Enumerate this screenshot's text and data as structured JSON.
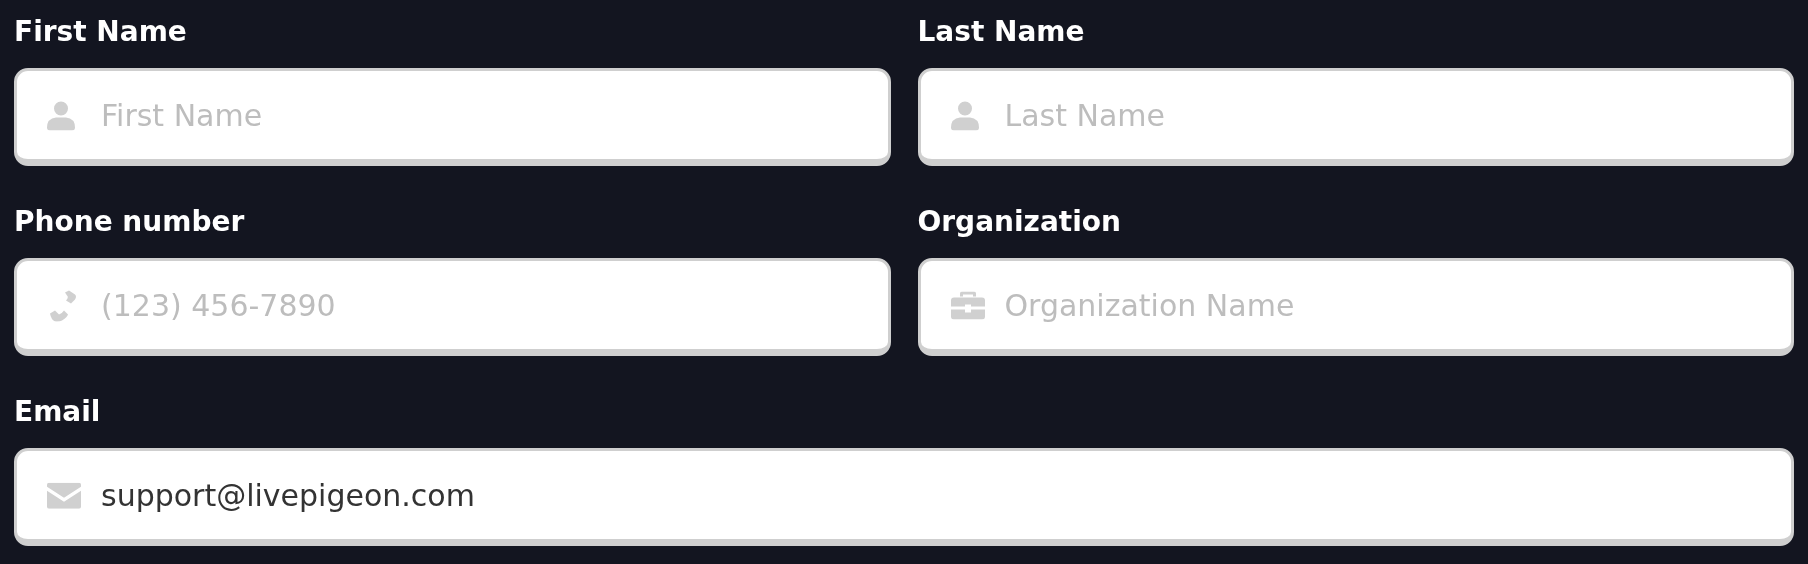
{
  "fields": [
    {
      "label": "First Name",
      "kind": "person",
      "placeholder": "First Name",
      "wide": false
    },
    {
      "label": "Last Name",
      "kind": "person",
      "placeholder": "Last Name",
      "wide": false
    },
    {
      "label": "Phone number",
      "kind": "phone",
      "placeholder": "(123) 456-7890",
      "wide": false
    },
    {
      "label": "Organization",
      "kind": "organization",
      "placeholder": "Organization Name",
      "wide": false
    },
    {
      "label": "Email",
      "kind": "email",
      "value": "support@livepigeon.com",
      "wide": true
    }
  ]
}
